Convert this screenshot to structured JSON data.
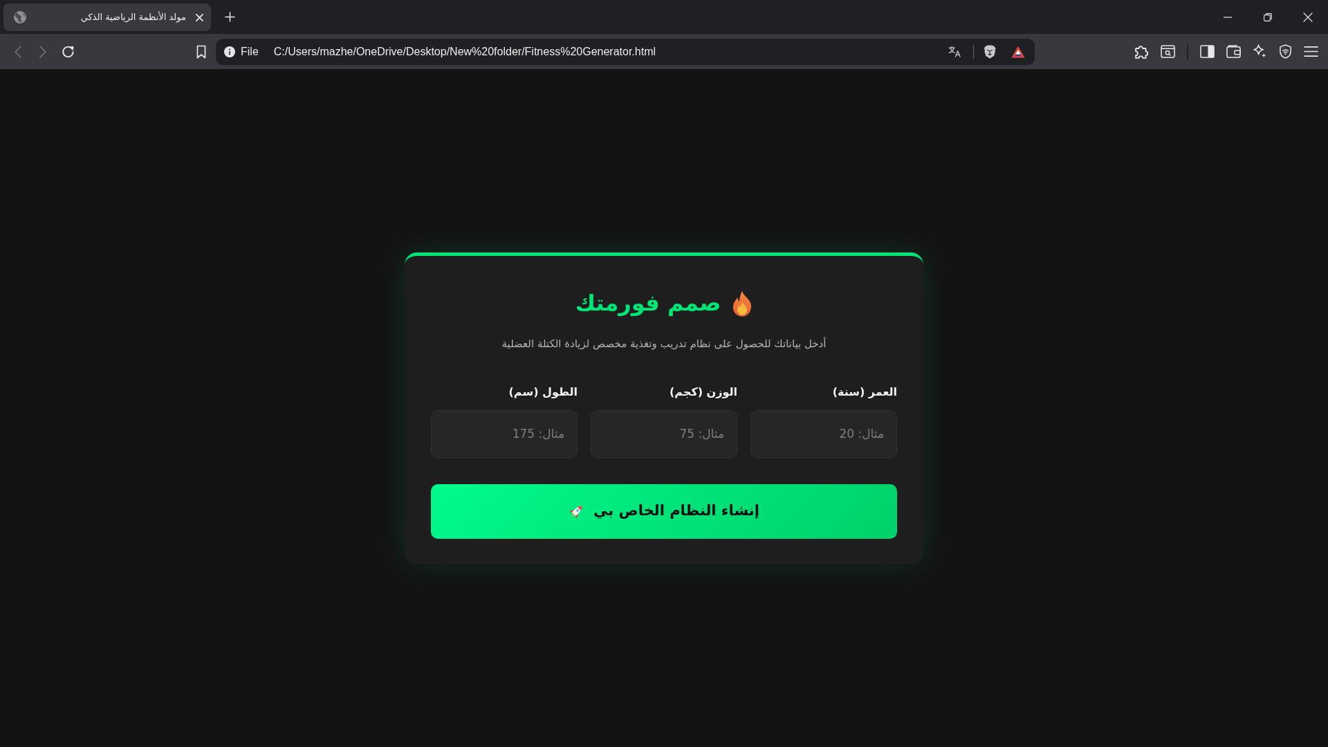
{
  "browser": {
    "tabs": [
      {
        "title": "مولد الأنظمة الرياضية الذكي",
        "selected": true
      }
    ],
    "toolbar": {
      "back": {
        "disabled": true
      },
      "forward": {
        "disabled": true
      }
    },
    "address_bar": {
      "scheme": "File",
      "url": "C:/Users/mazhe/OneDrive/Desktop/New%20folder/Fitness%20Generator.html"
    }
  },
  "form_card": {
    "title": "صمم فورمتك",
    "subtitle": "أدخل بياناتك للحصول على نظام تدريب وتغذية مخصص لزيادة الكتلة العضلية",
    "fields": [
      {
        "label": "العمر (سنة)",
        "placeholder": "مثال: 20"
      },
      {
        "label": "الوزن (كجم)",
        "placeholder": "مثال: 75"
      },
      {
        "label": "الطول (سم)",
        "placeholder": "مثال: 175"
      }
    ],
    "submit_button": {
      "label": "إنشاء النظام الخاص بي"
    }
  }
}
